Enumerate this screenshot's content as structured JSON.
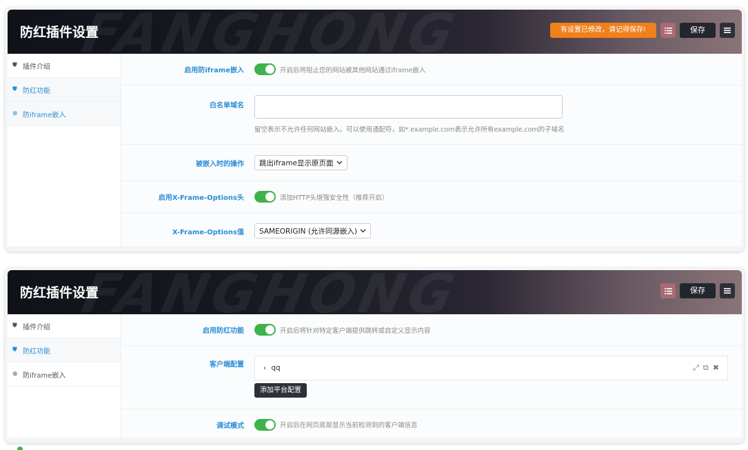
{
  "panels": [
    {
      "title": "防红插件设置",
      "watermark": "FANGHONG",
      "unsaved_notice": "有设置已修改，请记得保存!",
      "save_label": "保存",
      "sidebar": [
        {
          "label": "插件介绍",
          "icon": "shield-icon"
        },
        {
          "label": "防红功能",
          "icon": "shield-icon"
        },
        {
          "label": "防iframe嵌入",
          "icon": "circle-x-icon"
        }
      ],
      "rows": {
        "iframe_enable": {
          "label": "启用防iframe嵌入",
          "hint": "开启后将阻止您的网站被其他网站通过iframe嵌入",
          "on": true
        },
        "whitelist": {
          "label": "白名单域名",
          "value": "",
          "hint": "留空表示不允许任何网站嵌入。可以使用通配符，如*.example.com表示允许所有example.com的子域名"
        },
        "embed_action": {
          "label": "被嵌入时的操作",
          "selected": "跳出iframe显示原页面"
        },
        "xfo_enable": {
          "label": "启用X-Frame-Options头",
          "hint": "添加HTTP头增强安全性（推荐开启）",
          "on": true
        },
        "xfo_value": {
          "label": "X-Frame-Options值",
          "selected": "SAMEORIGIN (允许同源嵌入)"
        }
      }
    },
    {
      "title": "防红插件设置",
      "watermark": "FANGHONG",
      "save_label": "保存",
      "sidebar": [
        {
          "label": "插件介绍",
          "icon": "shield-icon"
        },
        {
          "label": "防红功能",
          "icon": "shield-icon"
        },
        {
          "label": "防iframe嵌入",
          "icon": "circle-x-icon"
        }
      ],
      "rows": {
        "fh_enable": {
          "label": "启用防红功能",
          "hint": "开启后将针对特定客户端提供跳转或自定义显示内容",
          "on": true
        },
        "client_config": {
          "label": "客户端配置",
          "client_name": "qq",
          "add_label": "添加平台配置"
        },
        "debug": {
          "label": "调试模式",
          "hint": "开启后在网页底部显示当前检测到的客户端信息",
          "on": true
        }
      }
    }
  ],
  "colors": {
    "accent": "#2a8fd8",
    "toggle_on": "#3db34a",
    "warning": "#f0801c"
  }
}
